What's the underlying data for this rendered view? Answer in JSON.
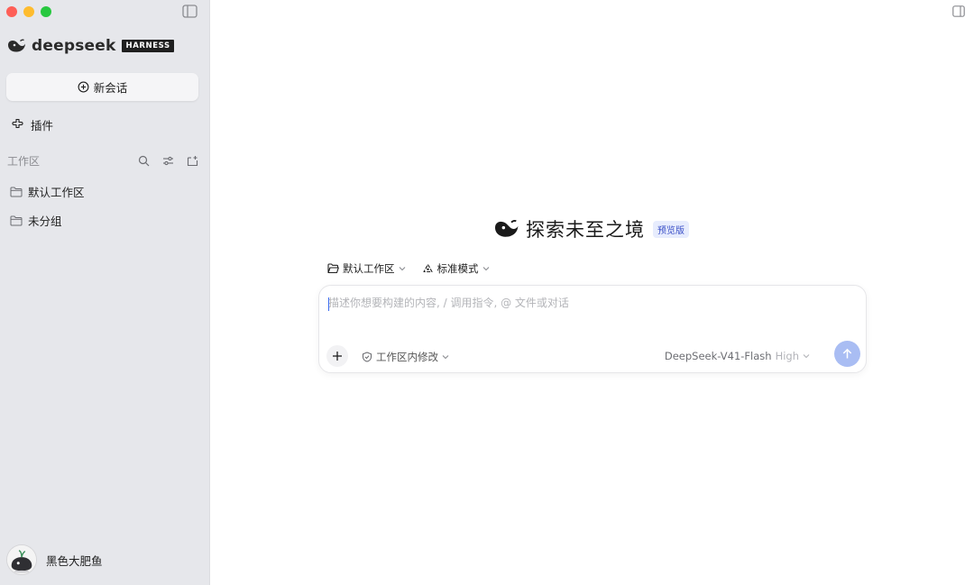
{
  "sidebar": {
    "brand_name": "deepseek",
    "brand_badge": "HARNESS",
    "new_chat_label": "新会话",
    "plugins_label": "插件",
    "workspace_title": "工作区",
    "workspaces": [
      {
        "label": "默认工作区",
        "icon": "folder-icon"
      },
      {
        "label": "未分组",
        "icon": "folder-icon"
      }
    ],
    "user_name": "黑色大肥鱼"
  },
  "main": {
    "hero_title": "探索未至之境",
    "hero_badge": "预览版",
    "workspace_select": "默认工作区",
    "mode_select": "标准模式",
    "prompt_placeholder": "描述你想要构建的内容, / 调用指令, @ 文件或对话",
    "scope_label": "工作区内修改",
    "model_name": "DeepSeek-V41-Flash",
    "model_level": "High"
  },
  "colors": {
    "sidebar_bg": "#e6e7eb",
    "accent": "#3b6cf0",
    "send_button": "#a9bdf3",
    "badge_bg": "#e7ecfd",
    "badge_text": "#3a4fc7"
  }
}
